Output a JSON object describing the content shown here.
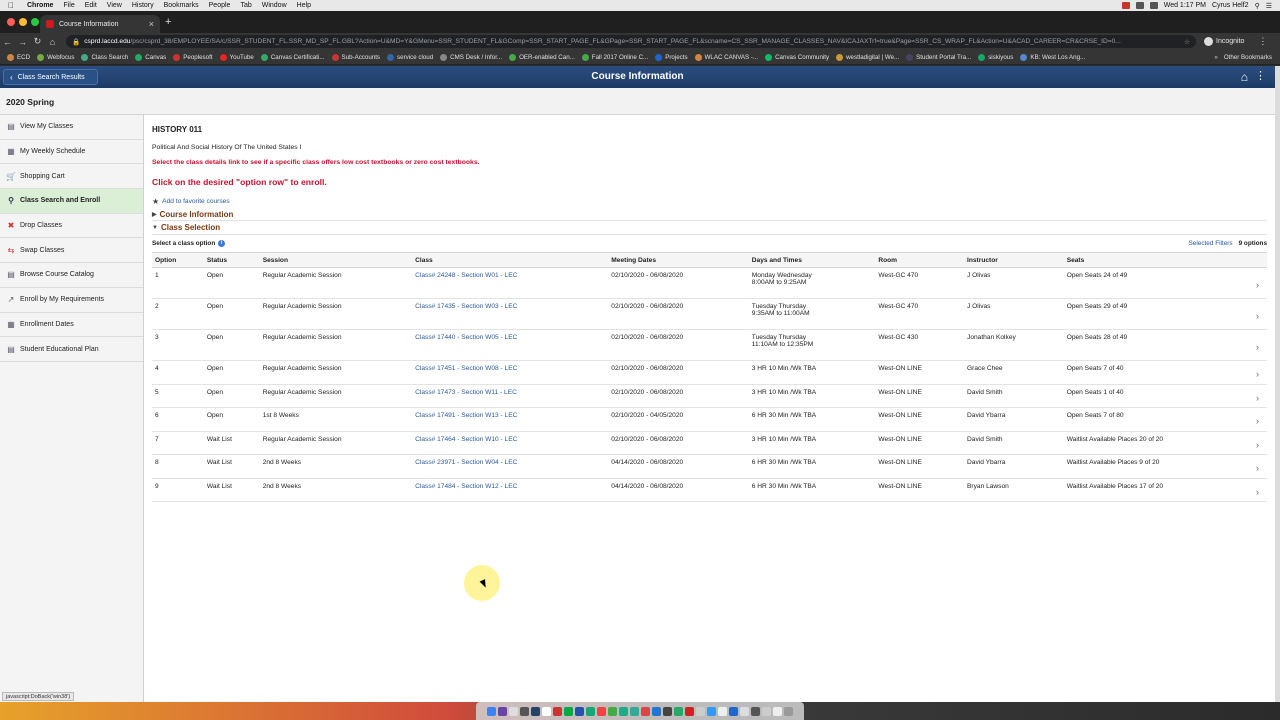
{
  "mac_menu": {
    "items": [
      "Chrome",
      "File",
      "Edit",
      "View",
      "History",
      "Bookmarks",
      "People",
      "Tab",
      "Window",
      "Help"
    ],
    "clock": "Wed 1:17 PM",
    "user": "Cyrus Helf2"
  },
  "browser": {
    "tab_title": "Course Information",
    "url_host": "csprd.laccd.edu",
    "url_path": "/psc/csprd_38/EMPLOYEE/SA/c/SSR_STUDENT_FL.SSR_MD_SP_FL.GBL?Action=U&MD=Y&GMenu=SSR_STUDENT_FL&GComp=SSR_START_PAGE_FL&GPage=SSR_START_PAGE_FL&scname=CS_SSR_MANAGE_CLASSES_NAV&ICAJAXTrf=true&Page=SSR_CS_WRAP_FL&Action=U&ACAD_CAREER=CR&CRSE_ID=0...",
    "incognito_label": "Incognito",
    "bookmarks": [
      "ECD",
      "Webfocus",
      "Class Search",
      "Canvas",
      "Peoplesoft",
      "YouTube",
      "Canvas Certificati...",
      "Sub-Accounts",
      "service cloud",
      "CMS Desk / Infor...",
      "OER-enabled Can...",
      "Fall 2017 Online C...",
      "Projects",
      "WLAC CANVAS -...",
      "Canvas Community",
      "westladigital | We...",
      "Student Portal Tra...",
      "siskiyous",
      "KB: West Los Ang..."
    ],
    "other_bookmarks": "Other Bookmarks",
    "status_text": "javascript:DoBack('win38')"
  },
  "header": {
    "back_label": "Class Search Results",
    "title": "Course Information"
  },
  "term": "2020 Spring",
  "sidebar": {
    "items": [
      {
        "label": "View My Classes",
        "icon": "list-icon"
      },
      {
        "label": "My Weekly Schedule",
        "icon": "calendar-icon"
      },
      {
        "label": "Shopping Cart",
        "icon": "cart-icon"
      },
      {
        "label": "Class Search and Enroll",
        "icon": "search-icon"
      },
      {
        "label": "Drop Classes",
        "icon": "drop-icon"
      },
      {
        "label": "Swap Classes",
        "icon": "swap-icon"
      },
      {
        "label": "Browse Course Catalog",
        "icon": "catalog-icon"
      },
      {
        "label": "Enroll by My Requirements",
        "icon": "chart-icon"
      },
      {
        "label": "Enrollment Dates",
        "icon": "dates-icon"
      },
      {
        "label": "Student Educational Plan",
        "icon": "plan-icon"
      }
    ]
  },
  "course": {
    "code": "HISTORY 011",
    "title": "Political And Social History Of The United States I",
    "notice": "Select the class details link to see if a specific class offers low cost textbooks or zero cost textbooks.",
    "instruction": "Click on the desired \"option row\" to enroll.",
    "favorite": "Add to favorite courses",
    "section_info": "Course Information",
    "section_selection": "Class Selection",
    "select_label": "Select a class option",
    "filters_label": "Selected Filters",
    "options_count": "9 options"
  },
  "table": {
    "headers": [
      "Option",
      "Status",
      "Session",
      "Class",
      "Meeting Dates",
      "Days and Times",
      "Room",
      "Instructor",
      "Seats"
    ],
    "rows": [
      {
        "option": "1",
        "status": "Open",
        "session": "Regular Academic Session",
        "class": "Class# 24248 - Section W01 - LEC",
        "dates": "02/10/2020 - 06/08/2020",
        "days": "Monday Wednesday",
        "times": "8:00AM to 9:25AM",
        "room": "West-GC 470",
        "instructor": "J Olivas",
        "seats": "Open Seats 24 of 49"
      },
      {
        "option": "2",
        "status": "Open",
        "session": "Regular Academic Session",
        "class": "Class# 17435 - Section W03 - LEC",
        "dates": "02/10/2020 - 06/08/2020",
        "days": "Tuesday Thursday",
        "times": "9:35AM to 11:00AM",
        "room": "West-GC 470",
        "instructor": "J Olivas",
        "seats": "Open Seats 29 of 49"
      },
      {
        "option": "3",
        "status": "Open",
        "session": "Regular Academic Session",
        "class": "Class# 17440 - Section W05 - LEC",
        "dates": "02/10/2020 - 06/08/2020",
        "days": "Tuesday Thursday",
        "times": "11:10AM to 12:35PM",
        "room": "West-GC 430",
        "instructor": "Jonathan Kolkey",
        "seats": "Open Seats 28 of 49"
      },
      {
        "option": "4",
        "status": "Open",
        "session": "Regular Academic Session",
        "class": "Class# 17451 - Section W08 - LEC",
        "dates": "02/10/2020 - 06/08/2020",
        "days": "3 HR 10 Min /Wk TBA",
        "times": "",
        "room": "West-ON LINE",
        "instructor": "Grace Chee",
        "seats": "Open Seats 7 of 40"
      },
      {
        "option": "5",
        "status": "Open",
        "session": "Regular Academic Session",
        "class": "Class# 17473 - Section W11 - LEC",
        "dates": "02/10/2020 - 06/08/2020",
        "days": "3 HR 10 Min /Wk TBA",
        "times": "",
        "room": "West-ON LINE",
        "instructor": "David Smith",
        "seats": "Open Seats 1 of 40"
      },
      {
        "option": "6",
        "status": "Open",
        "session": "1st 8 Weeks",
        "class": "Class# 17491 - Section W13 - LEC",
        "dates": "02/10/2020 - 04/05/2020",
        "days": "6 HR 30 Min /Wk TBA",
        "times": "",
        "room": "West-ON LINE",
        "instructor": "David Ybarra",
        "seats": "Open Seats 7 of 80"
      },
      {
        "option": "7",
        "status": "Wait List",
        "session": "Regular Academic Session",
        "class": "Class# 17464 - Section W10 - LEC",
        "dates": "02/10/2020 - 06/08/2020",
        "days": "3 HR 10 Min /Wk TBA",
        "times": "",
        "room": "West-ON LINE",
        "instructor": "David Smith",
        "seats": "Waitlist Available Places 20 of 20"
      },
      {
        "option": "8",
        "status": "Wait List",
        "session": "2nd 8 Weeks",
        "class": "Class# 23971 - Section W04 - LEC",
        "dates": "04/14/2020 - 06/08/2020",
        "days": "6 HR 30 Min /Wk TBA",
        "times": "",
        "room": "West-ON LINE",
        "instructor": "David Ybarra",
        "seats": "Waitlist Available Places 9 of 20"
      },
      {
        "option": "9",
        "status": "Wait List",
        "session": "2nd 8 Weeks",
        "class": "Class# 17484 - Section W12 - LEC",
        "dates": "04/14/2020 - 06/08/2020",
        "days": "6 HR 30 Min /Wk TBA",
        "times": "",
        "room": "West-ON LINE",
        "instructor": "Bryan Lawson",
        "seats": "Waitlist Available Places 17 of 20"
      }
    ]
  },
  "colors": {
    "header_blue": "#1c3a66",
    "link_blue": "#2a5a9a",
    "alert_red": "#c8102e",
    "active_green": "#dbeed6"
  }
}
